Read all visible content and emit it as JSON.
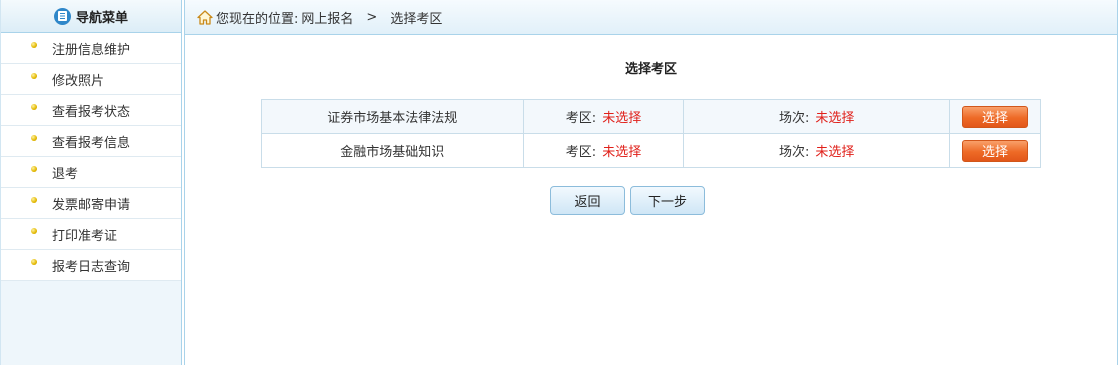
{
  "sidebar": {
    "title": "导航菜单",
    "items": [
      {
        "label": "注册信息维护"
      },
      {
        "label": "修改照片"
      },
      {
        "label": "查看报考状态"
      },
      {
        "label": "查看报考信息"
      },
      {
        "label": "退考"
      },
      {
        "label": "发票邮寄申请"
      },
      {
        "label": "打印准考证"
      },
      {
        "label": "报考日志查询"
      }
    ]
  },
  "breadcrumb": {
    "prefix": "您现在的位置:",
    "parent": "网上报名",
    "separator": ">",
    "current": "选择考区"
  },
  "main": {
    "title": "选择考区",
    "rows": [
      {
        "subject": "证券市场基本法律法规",
        "area_label": "考区:",
        "area_value": "未选择",
        "session_label": "场次:",
        "session_value": "未选择",
        "button": "选择"
      },
      {
        "subject": "金融市场基础知识",
        "area_label": "考区:",
        "area_value": "未选择",
        "session_label": "场次:",
        "session_value": "未选择",
        "button": "选择"
      }
    ],
    "back_label": "返回",
    "next_label": "下一步"
  },
  "colors": {
    "accent": "#2f87c9",
    "warning_text": "#e0201a",
    "select_button": "#ee6a26"
  },
  "icons": [
    "list-icon",
    "home-icon",
    "bullet-icon"
  ]
}
